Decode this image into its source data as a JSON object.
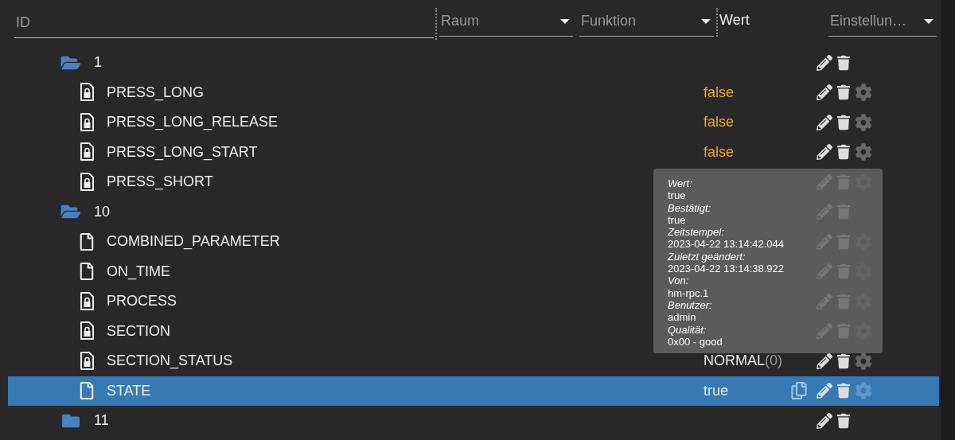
{
  "filters": {
    "id": {
      "placeholder": "ID"
    },
    "room": {
      "placeholder": "Raum"
    },
    "function": {
      "placeholder": "Funktion"
    },
    "value_heading": "Wert",
    "settings": {
      "placeholder": "Einstellun…"
    }
  },
  "tree": [
    {
      "kind": "folder",
      "name": "1",
      "expanded": true,
      "selected": false,
      "children": [
        {
          "kind": "state",
          "name": "PRESS_LONG",
          "readonly": true,
          "selected": false,
          "value": "false",
          "color": "#f5a623"
        },
        {
          "kind": "state",
          "name": "PRESS_LONG_RELEASE",
          "readonly": true,
          "selected": false,
          "value": "false",
          "color": "#f5a623"
        },
        {
          "kind": "state",
          "name": "PRESS_LONG_START",
          "readonly": true,
          "selected": false,
          "value": "false",
          "color": "#f5a623"
        },
        {
          "kind": "state",
          "name": "PRESS_SHORT",
          "readonly": true,
          "selected": false
        }
      ]
    },
    {
      "kind": "folder",
      "name": "10",
      "expanded": true,
      "selected": false,
      "children": [
        {
          "kind": "state",
          "name": "COMBINED_PARAMETER",
          "readonly": false,
          "selected": false
        },
        {
          "kind": "state",
          "name": "ON_TIME",
          "readonly": false,
          "selected": false
        },
        {
          "kind": "state",
          "name": "PROCESS",
          "readonly": true,
          "selected": false
        },
        {
          "kind": "state",
          "name": "SECTION",
          "readonly": true,
          "selected": false
        },
        {
          "kind": "state",
          "name": "SECTION_STATUS",
          "readonly": true,
          "selected": false,
          "value": "NORMAL",
          "value_suffix": "(0)",
          "color": "#eeeeee"
        },
        {
          "kind": "state",
          "name": "STATE",
          "readonly": false,
          "selected": true,
          "value": "true",
          "color": "#eeeeee"
        }
      ]
    },
    {
      "kind": "folder",
      "name": "11",
      "expanded": false,
      "selected": false
    }
  ],
  "tooltip": {
    "fields": [
      {
        "label": "Wert:",
        "value": "true"
      },
      {
        "label": "Bestätigt:",
        "value": "true"
      },
      {
        "label": "Zeitstempel:",
        "value": "2023-04-22 13:14:42.044"
      },
      {
        "label": "Zuletzt geändert:",
        "value": "2023-04-22 13:14:38.922"
      },
      {
        "label": "Von:",
        "value": "hm-rpc.1"
      },
      {
        "label": "Benutzer:",
        "value": "admin"
      },
      {
        "label": "Qualität:",
        "value": "0x00 - good"
      }
    ]
  }
}
